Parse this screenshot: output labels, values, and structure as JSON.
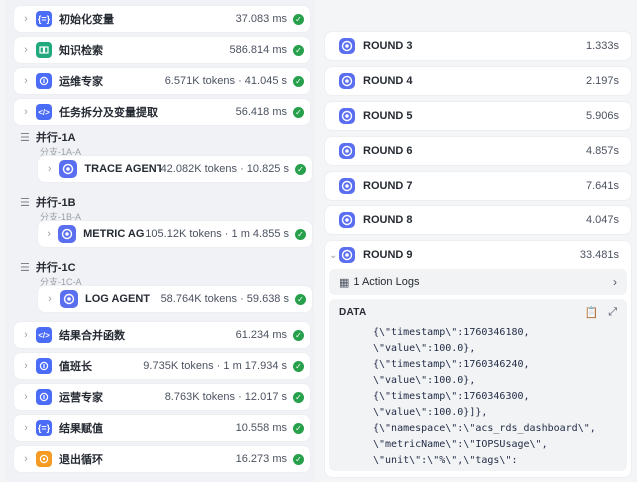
{
  "left_steps": [
    {
      "name": "初始化变量",
      "meta": "37.083 ms",
      "icon": "variable-icon",
      "color": "#4a6cf7"
    },
    {
      "name": "知识检索",
      "meta": "586.814 ms",
      "icon": "book-icon",
      "color": "#21a87d"
    },
    {
      "name": "运维专家",
      "meta": "6.571K tokens · 41.045 s",
      "icon": "expert-icon",
      "color": "#4a6cf7"
    },
    {
      "name": "任务拆分及变量提取",
      "meta": "56.418 ms",
      "icon": "code-icon",
      "color": "#4a6cf7"
    }
  ],
  "parallel_groups": [
    {
      "title": "并行-1A",
      "branch": "分支-1A-A",
      "agent": {
        "name": "TRACE AGENT",
        "meta": "42.082K tokens · 10.825 s"
      }
    },
    {
      "title": "并行-1B",
      "branch": "分支-1B-A",
      "agent": {
        "name": "METRIC AG...",
        "meta": "105.12K tokens · 1 m 4.855 s"
      }
    },
    {
      "title": "并行-1C",
      "branch": "分支-1C-A",
      "agent": {
        "name": "LOG AGENT",
        "meta": "58.764K tokens · 59.638 s"
      }
    }
  ],
  "left_steps_after": [
    {
      "name": "结果合并函数",
      "meta": "61.234 ms",
      "icon": "code-icon",
      "color": "#4a6cf7"
    },
    {
      "name": "值班长",
      "meta": "9.735K tokens · 1 m 17.934 s",
      "icon": "expert-icon",
      "color": "#4a6cf7"
    },
    {
      "name": "运营专家",
      "meta": "8.763K tokens · 12.017 s",
      "icon": "expert-icon",
      "color": "#4a6cf7"
    },
    {
      "name": "结果赋值",
      "meta": "10.558 ms",
      "icon": "variable-icon",
      "color": "#4a6cf7"
    },
    {
      "name": "退出循环",
      "meta": "16.273 ms",
      "icon": "exit-icon",
      "color": "#f59a22"
    }
  ],
  "rounds": [
    {
      "name": "ROUND 3",
      "time": "1.333s"
    },
    {
      "name": "ROUND 4",
      "time": "2.197s"
    },
    {
      "name": "ROUND 5",
      "time": "5.906s"
    },
    {
      "name": "ROUND 6",
      "time": "4.857s"
    },
    {
      "name": "ROUND 7",
      "time": "7.641s"
    },
    {
      "name": "ROUND 8",
      "time": "4.047s"
    }
  ],
  "expanded_round": {
    "name": "ROUND 9",
    "time": "33.481s",
    "action_logs": "1 Action Logs",
    "data_label": "DATA",
    "code_lines": [
      "{\\\"timestamp\\\":1760346180,",
      "\\\"value\\\":100.0},",
      "{\\\"timestamp\\\":1760346240,",
      "\\\"value\\\":100.0},",
      "{\\\"timestamp\\\":1760346300,",
      "\\\"value\\\":100.0}]},",
      "{\\\"namespace\\\":\\\"acs_rds_dashboard\\\",",
      "\\\"metricName\\\":\\\"IOPSUsage\\\",",
      "\\\"unit\\\":\\\"%\\\",\\\"tags\\\":"
    ]
  }
}
